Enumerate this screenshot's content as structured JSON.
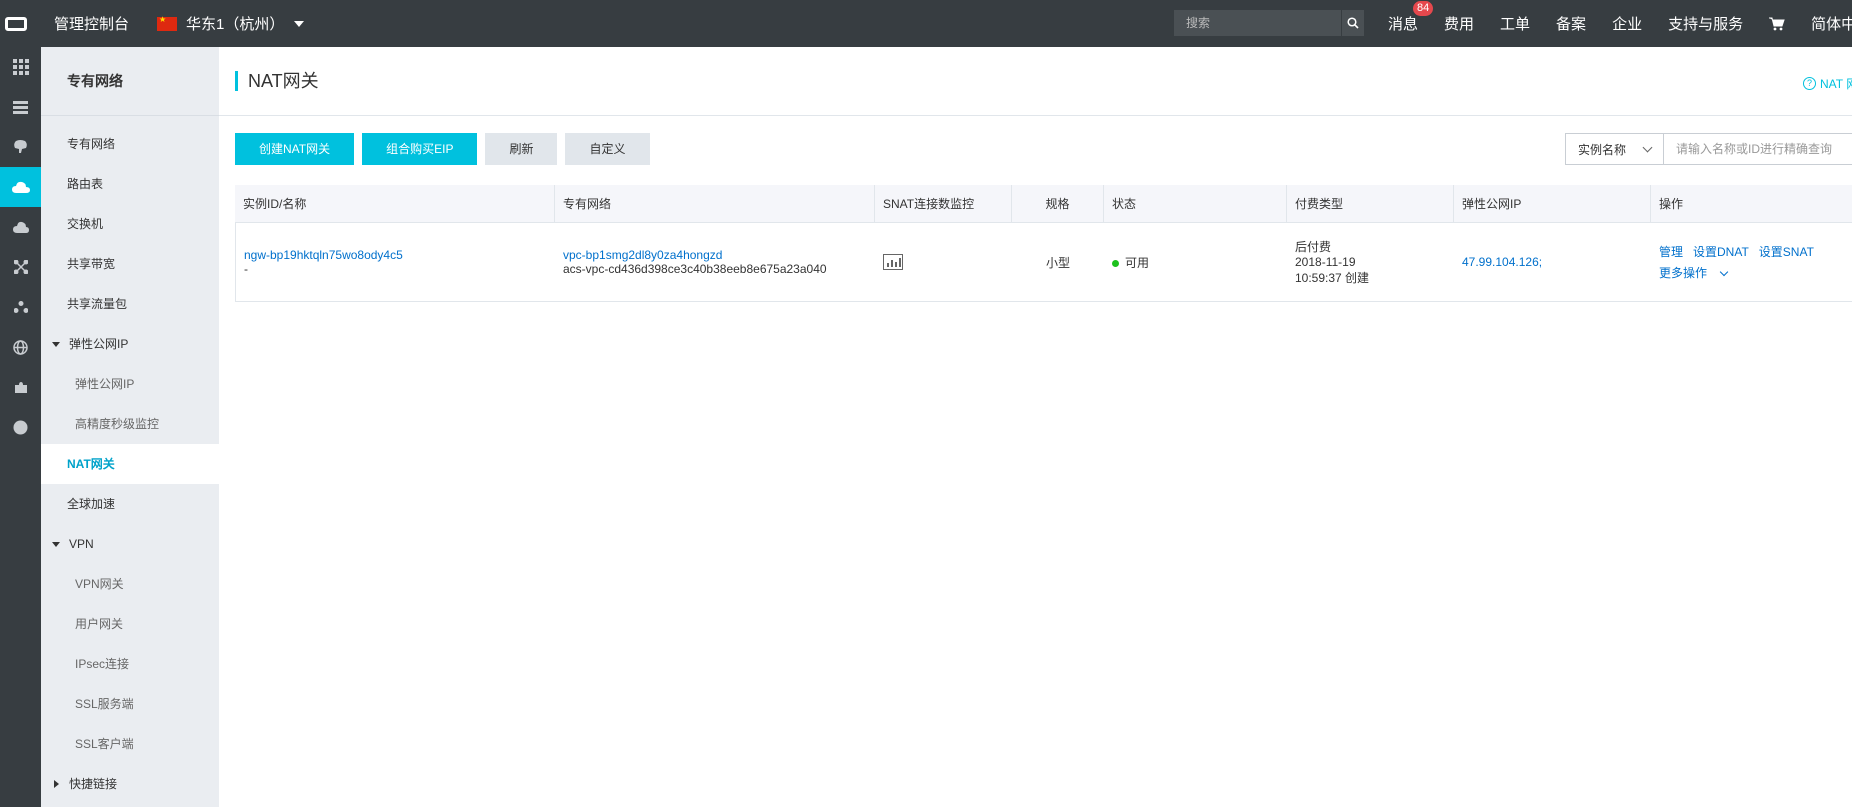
{
  "topbar": {
    "console_title": "管理控制台",
    "region": "华东1（杭州）",
    "search_placeholder": "搜索",
    "links": {
      "messages": "消息",
      "messages_badge": "84",
      "billing": "费用",
      "tickets": "工单",
      "icp": "备案",
      "enterprise": "企业",
      "support": "支持与服务",
      "language": "简体中文"
    }
  },
  "sidebar": {
    "title": "专有网络",
    "items": {
      "vpc": "专有网络",
      "route_table": "路由表",
      "vswitch": "交换机",
      "shared_bandwidth": "共享带宽",
      "shared_traffic": "共享流量包",
      "eip_group": "弹性公网IP",
      "eip": "弹性公网IP",
      "hp_monitor": "高精度秒级监控",
      "nat": "NAT网关",
      "global_accel": "全球加速",
      "vpn_group": "VPN",
      "vpn_gateway": "VPN网关",
      "customer_gateway": "用户网关",
      "ipsec": "IPsec连接",
      "ssl_server": "SSL服务端",
      "ssl_client": "SSL客户端",
      "shortcuts": "快捷链接"
    }
  },
  "main": {
    "title": "NAT网关",
    "help": "NAT 网",
    "toolbar": {
      "create": "创建NAT网关",
      "buy_eip": "组合购买EIP",
      "refresh": "刷新",
      "customize": "自定义"
    },
    "filter": {
      "field": "实例名称",
      "placeholder": "请输入名称或ID进行精确查询"
    },
    "table": {
      "headers": {
        "id": "实例ID/名称",
        "vpc": "专有网络",
        "snat": "SNAT连接数监控",
        "spec": "规格",
        "status": "状态",
        "billing": "付费类型",
        "eip": "弹性公网IP",
        "ops": "操作"
      },
      "row": {
        "id": "ngw-bp19hktqln75wo8ody4c5",
        "name": "-",
        "vpc_id": "vpc-bp1smg2dl8y0za4hongzd",
        "vpc_name": "acs-vpc-cd436d398ce3c40b38eeb8e675a23a040",
        "spec": "小型",
        "status": "可用",
        "billing_type": "后付费",
        "billing_date": "2018-11-19",
        "billing_time": "10:59:37 创建",
        "eip": "47.99.104.126;",
        "op_manage": "管理",
        "op_dnat": "设置DNAT",
        "op_snat": "设置SNAT",
        "op_more": "更多操作"
      }
    }
  },
  "colors": {
    "topbar_bg": "#373d41",
    "accent": "#00c1de",
    "link": "#0070cc",
    "status_ok": "#1dc11d",
    "badge": "#e5484d"
  }
}
